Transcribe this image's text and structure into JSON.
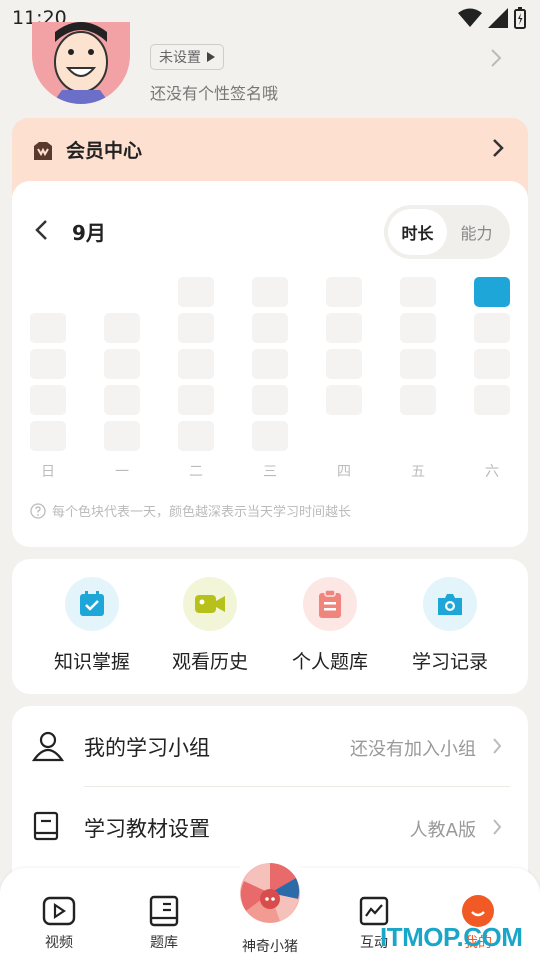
{
  "status_bar": {
    "time": "11:20"
  },
  "profile": {
    "tag_label": "未设置",
    "signature": "还没有个性签名哦"
  },
  "member": {
    "label": "会员中心"
  },
  "calendar": {
    "month": "9月",
    "toggle": [
      "时长",
      "能力"
    ],
    "active_toggle": "时长",
    "weekdays": [
      "日",
      "一",
      "二",
      "三",
      "四",
      "五",
      "六"
    ],
    "highlighted_day": 5,
    "hint": "每个色块代表一天，颜色越深表示当天学习时间越长"
  },
  "actions": [
    {
      "label": "知识掌握",
      "icon": "calendar-check-icon",
      "color": "#1fa6d9",
      "bg": "#e4f4fb"
    },
    {
      "label": "观看历史",
      "icon": "video-camera-icon",
      "color": "#b6c21b",
      "bg": "#f2f5d8"
    },
    {
      "label": "个人题库",
      "icon": "clipboard-icon",
      "color": "#f0857d",
      "bg": "#fde7e5"
    },
    {
      "label": "学习记录",
      "icon": "camera-icon",
      "color": "#1fa6d9",
      "bg": "#e4f4fb"
    }
  ],
  "list": [
    {
      "label": "我的学习小组",
      "value": "还没有加入小组",
      "icon": "person-icon"
    },
    {
      "label": "学习教材设置",
      "value": "人教A版",
      "icon": "book-icon"
    }
  ],
  "bottom_nav": [
    {
      "label": "视频",
      "icon": "play-icon"
    },
    {
      "label": "题库",
      "icon": "question-bank-icon"
    },
    {
      "label": "神奇小猪",
      "icon": "pig-avatar-icon"
    },
    {
      "label": "互动",
      "icon": "chart-icon"
    },
    {
      "label": "我的",
      "icon": "smile-icon",
      "active": true
    }
  ],
  "watermark": "ITMOP.COM",
  "colors": {
    "accent": "#1fa6d9",
    "active_nav": "#f15a24",
    "member_bg": "#fde0d0"
  }
}
